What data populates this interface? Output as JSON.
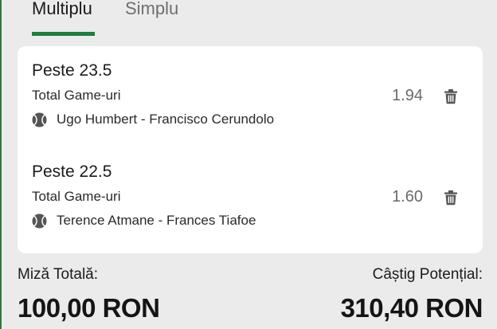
{
  "tabs": {
    "multiple_label": "Multiplu",
    "single_label": "Simplu"
  },
  "selections": [
    {
      "title": "Peste 23.5",
      "market": "Total Game-uri",
      "event": "Ugo Humbert - Francisco Cerundolo",
      "odds": "1.94",
      "sport_icon": "tennis-ball-icon",
      "remove_icon": "trash-icon"
    },
    {
      "title": "Peste 22.5",
      "market": "Total Game-uri",
      "event": "Terence Atmane - Frances Tiafoe",
      "odds": "1.60",
      "sport_icon": "tennis-ball-icon",
      "remove_icon": "trash-icon"
    }
  ],
  "summary": {
    "stake_label": "Miză Totală:",
    "stake_value": "100,00 RON",
    "potential_win_label": "Câștig Potențial:",
    "potential_win_value": "310,40 RON"
  },
  "colors": {
    "accent": "#1e7e3c",
    "background": "#ebebeb",
    "card": "#ffffff",
    "odds_text": "#6a6a6a"
  }
}
